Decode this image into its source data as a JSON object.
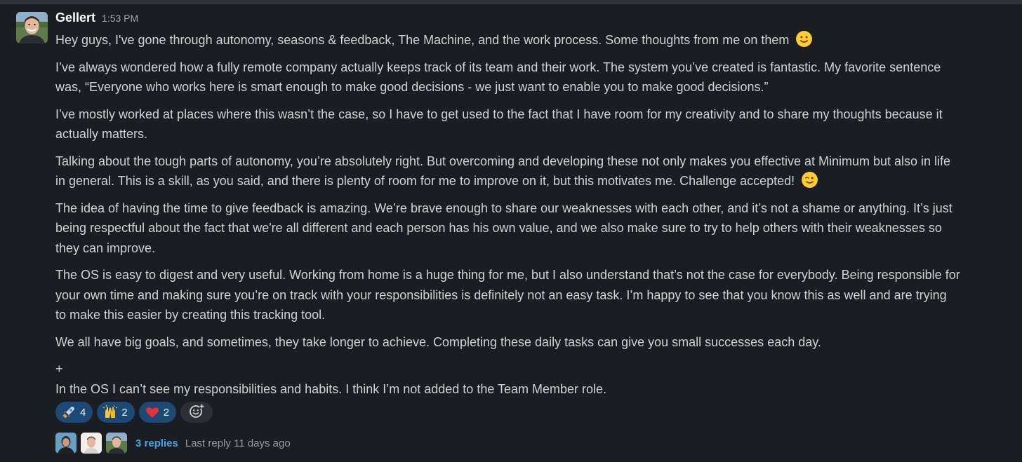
{
  "message": {
    "author": "Gellert",
    "time": "1:53 PM",
    "paragraphs": [
      [
        "Hey guys, I've gone through autonomy, seasons & feedback, The Machine, and the work process. Some thoughts from me on them"
      ],
      [
        "I’ve always wondered how a fully remote company actually keeps track of its team and their work. The system you’ve created is fantastic. My favorite sentence",
        "was, “Everyone who works here is smart enough to make good decisions - we just want to enable you to make good decisions.”"
      ],
      [
        "I’ve mostly worked at places where this wasn’t the case, so I have to get used to the fact that I have room for my creativity and to share my thoughts because it",
        "actually matters."
      ],
      [
        "Talking about the tough parts of autonomy, you’re absolutely right. But overcoming and developing these not only makes you effective at Minimum but also in life",
        "in general. This is a skill, as you said, and there is plenty of room for me to improve on it, but this motivates me. Challenge accepted!"
      ],
      [
        "The idea of having the time to give feedback is amazing. We’re brave enough to share our weaknesses with each other, and it’s not a shame or anything. It’s just",
        "being respectful about the fact that we're all different and each person has his own value, and we also make sure to try to help others with their weaknesses so",
        "they can improve."
      ],
      [
        "The OS is easy to digest and very useful. Working from home is a huge thing for me, but I also understand that’s not the case for everybody. Being responsible for",
        "your own time and making sure you’re on track with your responsibilities is definitely not an easy task. I’m happy to see that you know this as well and are trying",
        "to make this easier by creating this tracking tool."
      ],
      [
        "We all have big goals, and sometimes, they take longer to achieve. Completing these daily tasks can give you small successes each day."
      ],
      [
        "+",
        "In the OS I can’t see my responsibilities and habits. I think I’m not added to the Team Member role."
      ]
    ],
    "emoji_smile": "slightly-smiling-face-icon",
    "emoji_wink": "winking-face-icon"
  },
  "reactions": [
    {
      "icon": "rocket-icon",
      "count": "4"
    },
    {
      "icon": "raised-hands-icon",
      "count": "2"
    },
    {
      "icon": "red-heart-icon",
      "count": "2"
    }
  ],
  "thread": {
    "replies_label": "3 replies",
    "last_reply_label": "Last reply 11 days ago"
  },
  "colors": {
    "background": "#1a1d21",
    "text": "#d1d2d3",
    "link": "#4aa3e0",
    "reaction_bg": "#1c4a75"
  }
}
